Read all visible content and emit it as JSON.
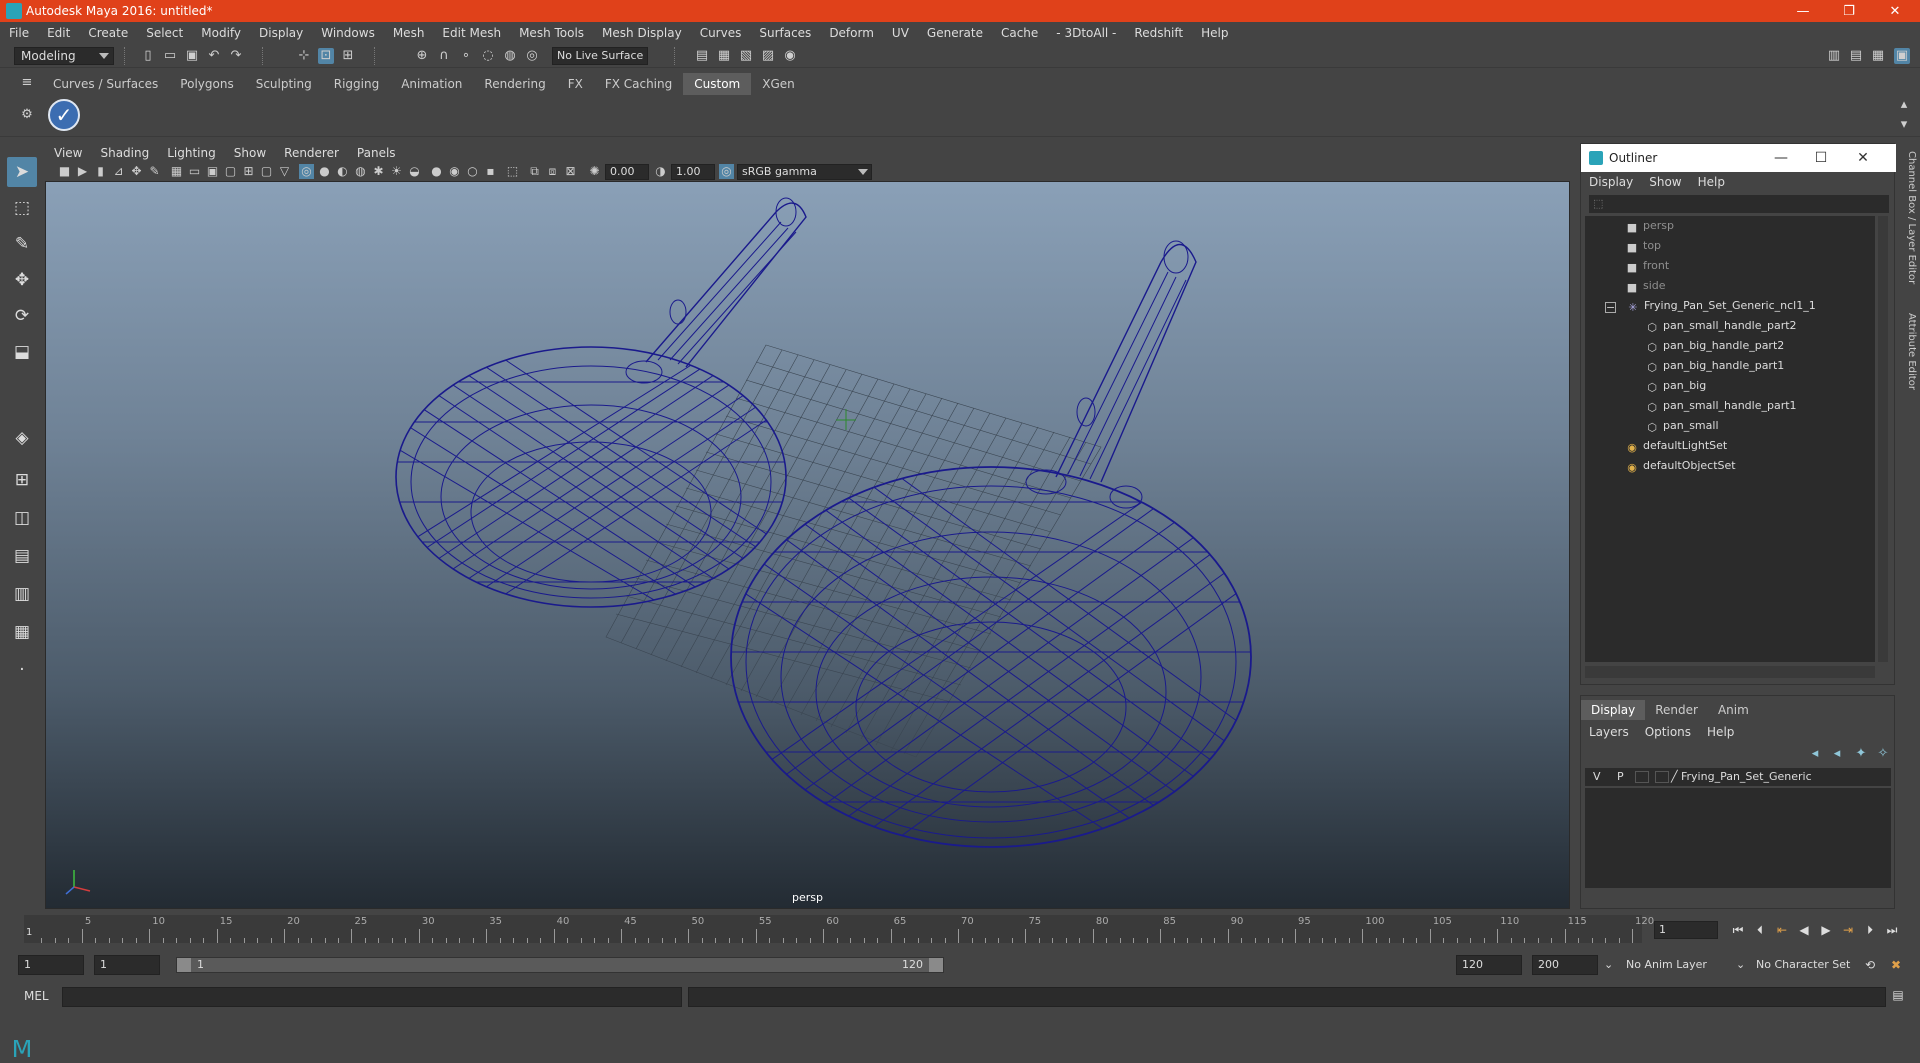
{
  "window": {
    "title": "Autodesk Maya 2016: untitled*",
    "controls": [
      "—",
      "❐",
      "✕"
    ]
  },
  "menubar": [
    "File",
    "Edit",
    "Create",
    "Select",
    "Modify",
    "Display",
    "Windows",
    "Mesh",
    "Edit Mesh",
    "Mesh Tools",
    "Mesh Display",
    "Curves",
    "Surfaces",
    "Deform",
    "UV",
    "Generate",
    "Cache",
    "- 3DtoAll -",
    "Redshift",
    "Help"
  ],
  "statusline": {
    "mode": "Modeling",
    "live_surface": "No Live Surface"
  },
  "shelf": {
    "tabs": [
      "Curves / Surfaces",
      "Polygons",
      "Sculpting",
      "Rigging",
      "Animation",
      "Rendering",
      "FX",
      "FX Caching",
      "Custom",
      "XGen"
    ],
    "active_tab": "Custom"
  },
  "panel": {
    "menu": [
      "View",
      "Shading",
      "Lighting",
      "Show",
      "Renderer",
      "Panels"
    ],
    "exposure": "0.00",
    "gamma": "1.00",
    "color_space": "sRGB gamma",
    "camera": "persp"
  },
  "outliner": {
    "title": "Outliner",
    "menu": [
      "Display",
      "Show",
      "Help"
    ],
    "items": [
      {
        "label": "persp",
        "icon": "camera-icon",
        "dim": true
      },
      {
        "label": "top",
        "icon": "camera-icon",
        "dim": true
      },
      {
        "label": "front",
        "icon": "camera-icon",
        "dim": true
      },
      {
        "label": "side",
        "icon": "camera-icon",
        "dim": true
      },
      {
        "label": "Frying_Pan_Set_Generic_ncl1_1",
        "icon": "group-icon",
        "dim": false
      },
      {
        "label": "pan_small_handle_part2",
        "icon": "mesh-icon",
        "dim": false
      },
      {
        "label": "pan_big_handle_part2",
        "icon": "mesh-icon",
        "dim": false
      },
      {
        "label": "pan_big_handle_part1",
        "icon": "mesh-icon",
        "dim": false
      },
      {
        "label": "pan_big",
        "icon": "mesh-icon",
        "dim": false
      },
      {
        "label": "pan_small_handle_part1",
        "icon": "mesh-icon",
        "dim": false
      },
      {
        "label": "pan_small",
        "icon": "mesh-icon",
        "dim": false
      },
      {
        "label": "defaultLightSet",
        "icon": "set-icon",
        "dim": false
      },
      {
        "label": "defaultObjectSet",
        "icon": "set-icon",
        "dim": false
      }
    ],
    "collapse_symbol": "−"
  },
  "sidetabs": [
    "Channel Box / Layer Editor",
    "Attribute Editor"
  ],
  "layers": {
    "tabs": [
      "Display",
      "Render",
      "Anim"
    ],
    "active_tab": "Display",
    "menu": [
      "Layers",
      "Options",
      "Help"
    ],
    "layer": {
      "v": "V",
      "p": "P",
      "name": "Frying_Pan_Set_Generic"
    }
  },
  "timeline": {
    "start_label": "1",
    "ticks": [
      "5",
      "10",
      "15",
      "20",
      "25",
      "30",
      "35",
      "40",
      "45",
      "50",
      "55",
      "60",
      "65",
      "70",
      "75",
      "80",
      "85",
      "90",
      "95",
      "100",
      "105",
      "110",
      "115",
      "120"
    ],
    "current_frame": "1"
  },
  "range": {
    "start": "1",
    "playback_start": "1",
    "slider_start": "1",
    "slider_end": "120",
    "playback_end": "120",
    "end": "200",
    "anim_layer": "No Anim Layer",
    "character_set": "No Character Set"
  },
  "cmdline": {
    "label": "MEL"
  },
  "colors": {
    "title_bar": "#e0411a",
    "active_blue": "#5285a6",
    "wire": "#1a1a8c",
    "panel_bg": "#444444"
  }
}
